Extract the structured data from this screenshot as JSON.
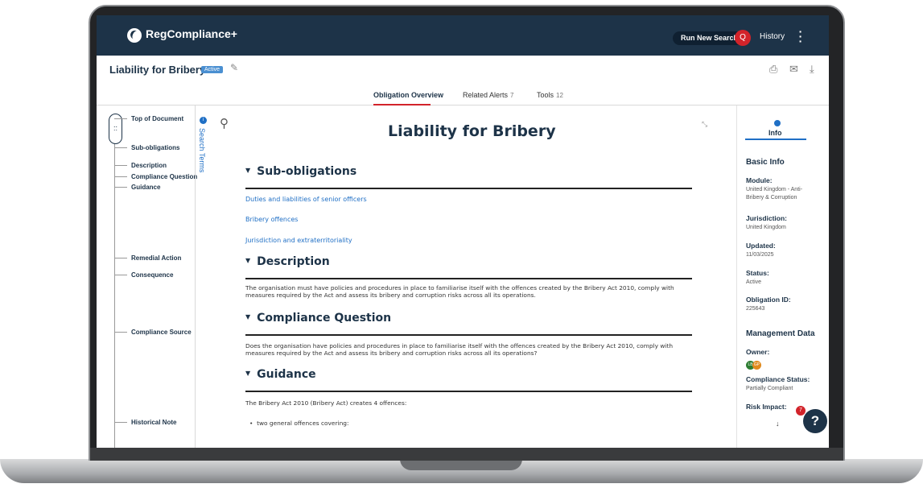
{
  "app": {
    "name": "RegCompliance+",
    "run_search_label": "Run New Search",
    "search_icon": "Q",
    "history_label": "History"
  },
  "document": {
    "title": "Liability for Bribery",
    "status_badge": "Active"
  },
  "tabs": [
    {
      "label": "Obligation Overview",
      "count": ""
    },
    {
      "label": "Related Alerts",
      "count": "7"
    },
    {
      "label": "Tools",
      "count": "12"
    }
  ],
  "nav": {
    "items": [
      "Top of Document",
      "Sub-obligations",
      "Description",
      "Compliance Question",
      "Guidance",
      "Remedial Action",
      "Consequence",
      "Compliance Source",
      "Historical Note"
    ]
  },
  "search_terms": {
    "label": "Search Terms"
  },
  "main": {
    "title": "Liability for Bribery",
    "sections": {
      "sub_obligations": "Sub-obligations",
      "description": "Description",
      "compliance_question": "Compliance Question",
      "guidance": "Guidance"
    },
    "sub_links": [
      "Duties and liabilities of senior officers",
      "Bribery offences",
      "Jurisdiction and extraterritoriality"
    ],
    "description_text": "The organisation must have policies and procedures in place to familiarise itself with the offences created by the Bribery Act 2010, comply with measures required by the Act and assess its bribery and corruption risks across all its operations.",
    "compliance_question_text": "Does the organisation have policies and procedures in place to familiarise itself with the offences created by the Bribery Act 2010, comply with measures required by the Act and assess its bribery and corruption risks across all its operations?",
    "guidance_text": "The Bribery Act 2010 (Bribery Act) creates 4 offences:",
    "guidance_bullet": "two general offences covering:"
  },
  "info_panel": {
    "tab_label": "Info",
    "basic_info_heading": "Basic Info",
    "module_label": "Module:",
    "module_value": "United Kingdom - Anti-Bribery & Corruption",
    "jurisdiction_label": "Jurisdiction:",
    "jurisdiction_value": "United Kingdom",
    "updated_label": "Updated:",
    "updated_value": "11/03/2025",
    "status_label": "Status:",
    "status_value": "Active",
    "obligation_id_label": "Obligation ID:",
    "obligation_id_value": "225643",
    "management_heading": "Management Data",
    "owner_label": "Owner:",
    "owners": [
      "LB",
      "GP"
    ],
    "compliance_status_label": "Compliance Status:",
    "compliance_status_value": "Partially Compliant",
    "risk_impact_label": "Risk Impact:"
  },
  "help": {
    "label": "?",
    "badge_count": "7"
  },
  "colors": {
    "navy": "#1d3348",
    "accent_red": "#d2232a",
    "link_blue": "#1f6fc5",
    "owner_green": "#2e7d32",
    "owner_orange": "#e08a1e"
  }
}
